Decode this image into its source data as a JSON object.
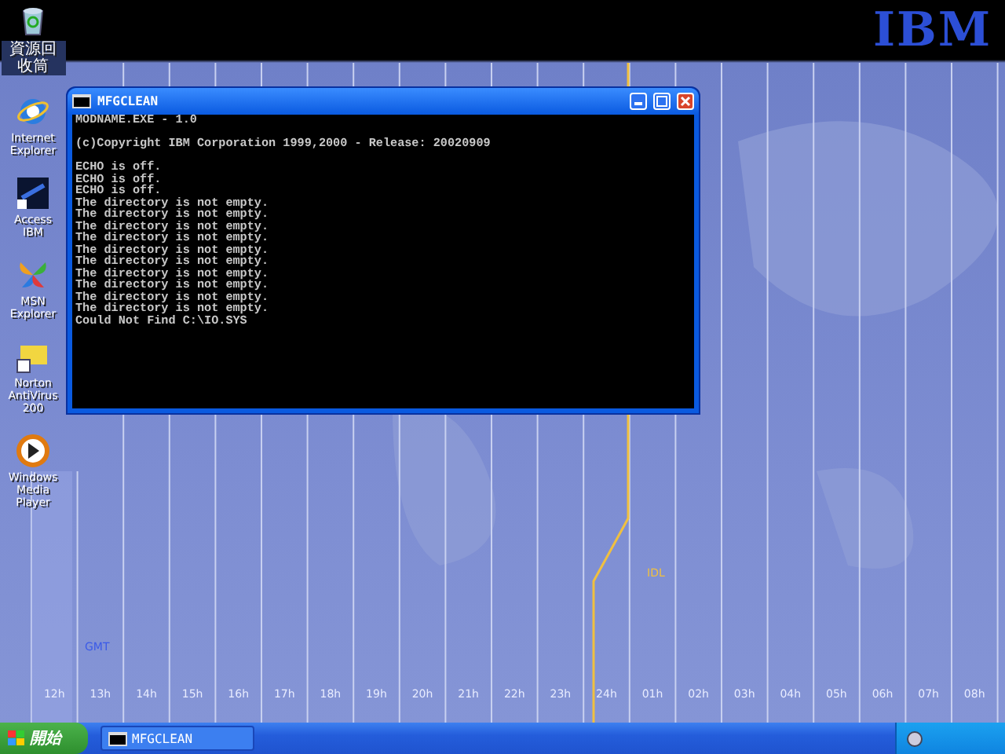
{
  "desktop_icons": [
    {
      "kind": "recycle-bin",
      "label": "資源回收筒"
    },
    {
      "kind": "browser",
      "label": "Internet Explorer"
    },
    {
      "kind": "ibm",
      "label": "Access IBM"
    },
    {
      "kind": "butterfly",
      "label": "MSN Explorer"
    },
    {
      "kind": "folder",
      "label": "Norton AntiVirus 200"
    },
    {
      "kind": "media",
      "label": "Windows Media Player"
    }
  ],
  "wallpaper": {
    "logo": "IBM",
    "gmt_label": "GMT",
    "idl_label": "IDL",
    "hours": [
      "12h",
      "13h",
      "14h",
      "15h",
      "16h",
      "17h",
      "18h",
      "19h",
      "20h",
      "21h",
      "22h",
      "23h",
      "24h",
      "01h",
      "02h",
      "03h",
      "04h",
      "05h",
      "06h",
      "07h",
      "08h"
    ]
  },
  "console_window": {
    "title": "MFGCLEAN",
    "blocks": [
      [
        "MODNAME.EXE - 1.0"
      ],
      [
        "(c)Copyright IBM Corporation 1999,2000 - Release: 20020909"
      ],
      [
        "ECHO is off.",
        "ECHO is off.",
        "ECHO is off.",
        "The directory is not empty.",
        "The directory is not empty.",
        "The directory is not empty.",
        "The directory is not empty.",
        "The directory is not empty.",
        "The directory is not empty.",
        "The directory is not empty.",
        "The directory is not empty.",
        "The directory is not empty.",
        "The directory is not empty.",
        "Could Not Find C:\\IO.SYS"
      ]
    ]
  },
  "taskbar": {
    "start_label": "開始",
    "tasks": [
      {
        "label": "MFGCLEAN"
      }
    ]
  }
}
